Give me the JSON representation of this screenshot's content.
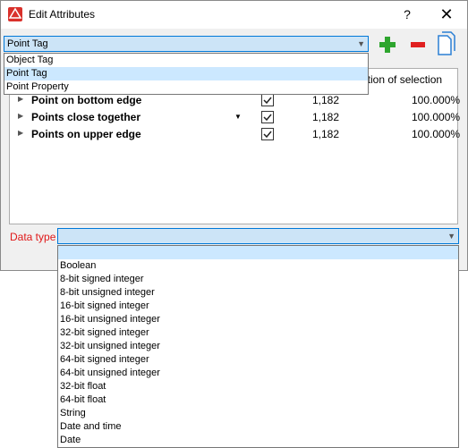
{
  "window": {
    "title": "Edit Attributes",
    "help": "?",
    "close": "✕"
  },
  "tag_select": {
    "value": "Point Tag",
    "options": [
      "Object Tag",
      "Point Tag",
      "Point Property"
    ]
  },
  "toolbar": {
    "add": "+",
    "remove": "−"
  },
  "table": {
    "header_portion": "ortion of selection",
    "rows": [
      {
        "name": "Point on bottom edge",
        "count": "1,182",
        "pct": "100.000%"
      },
      {
        "name": "Points close together",
        "count": "1,182",
        "pct": "100.000%"
      },
      {
        "name": "Points on upper edge",
        "count": "1,182",
        "pct": "100.000%"
      }
    ]
  },
  "data_type": {
    "label": "Data type",
    "value": "",
    "options": [
      "",
      "Boolean",
      "8-bit signed integer",
      "8-bit unsigned integer",
      "16-bit signed integer",
      "16-bit unsigned integer",
      "32-bit signed integer",
      "32-bit unsigned integer",
      "64-bit signed integer",
      "64-bit unsigned integer",
      "32-bit float",
      "64-bit float",
      "String",
      "Date and time",
      "Date"
    ]
  },
  "colors": {
    "accent": "#0078d7",
    "selection": "#cce8ff",
    "error_label": "#e01818",
    "add_icon": "#2ea52e",
    "remove_icon": "#e02020"
  },
  "icons": {
    "add": "plus-icon",
    "remove": "minus-icon",
    "copy": "copy-icon"
  }
}
